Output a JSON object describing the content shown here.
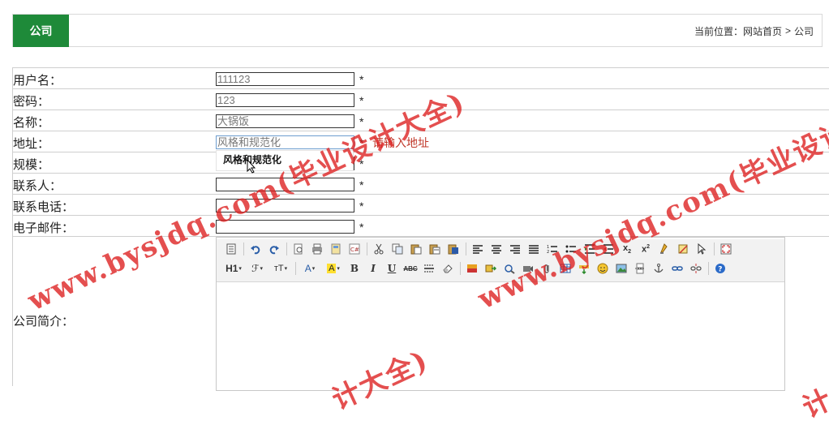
{
  "header": {
    "tab_label": "公司",
    "breadcrumb_prefix": "当前位置：",
    "breadcrumb_home": "网站首页",
    "breadcrumb_sep": ">",
    "breadcrumb_current": "公司"
  },
  "form": {
    "username_label": "用户名：",
    "username_value": "111123",
    "password_label": "密码：",
    "password_value": "123",
    "name_label": "名称：",
    "name_value": "大锅饭",
    "address_label": "地址：",
    "address_value": "风格和规范化",
    "address_error": "请输入地址",
    "scale_label": "规模：",
    "contact_label": "联系人：",
    "phone_label": "联系电话：",
    "email_label": "电子邮件：",
    "intro_label": "公司简介：",
    "required_mark": "*"
  },
  "autocomplete": {
    "suggestion": "风格和规范化"
  },
  "toolbar": {
    "h1_label": "H1",
    "font_label": "ℱ",
    "size_label": "тT",
    "font_color_label": "A",
    "bg_color_label": "A",
    "bold_label": "B",
    "italic_label": "I",
    "underline_label": "U",
    "strike_label": "ABC"
  },
  "watermark": {
    "text_a": "www.bysjdq.com(毕业设计大全)",
    "text_b": "www.bysjdq.com(毕业设计大全)",
    "text_c": "计大全)",
    "text_d": "计大",
    "color": "#dc1e1e"
  },
  "colors": {
    "accent_green": "#1e8a39",
    "error_red": "#c0392b"
  }
}
